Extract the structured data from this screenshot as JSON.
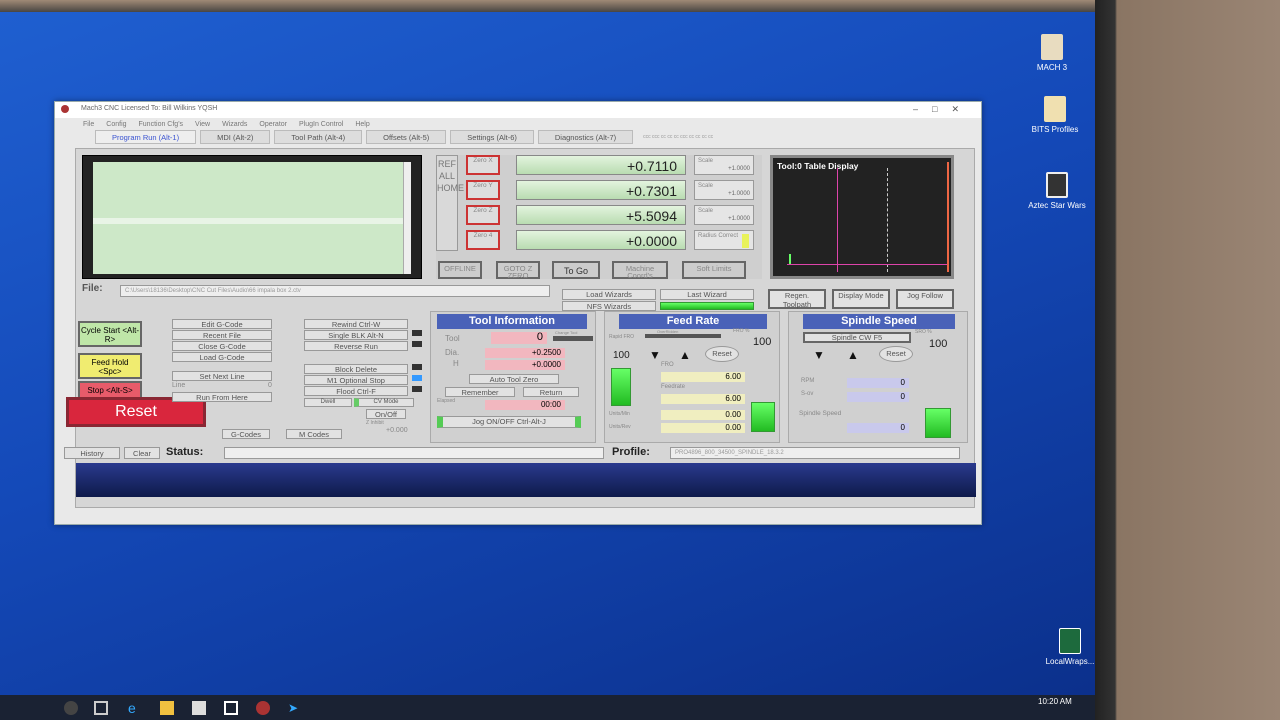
{
  "desktop": {
    "icons": [
      {
        "label": "MACH 3"
      },
      {
        "label": "BITS Profiles"
      },
      {
        "label": "Aztec Star Wars"
      },
      {
        "label": "LocalWraps..."
      }
    ]
  },
  "window": {
    "title": "Mach3 CNC  Licensed To: Bill Wilkins YQSH",
    "menu": [
      "File",
      "Config",
      "Function Cfg's",
      "View",
      "Wizards",
      "Operator",
      "PlugIn Control",
      "Help"
    ],
    "tabs": [
      "Program Run (Alt-1)",
      "MDI (Alt-2)",
      "Tool Path (Alt-4)",
      "Offsets (Alt-5)",
      "Settings (Alt-6)",
      "Diagnostics (Alt-7)"
    ],
    "tab_ticker": "ccc ccc cc cc cc ccc cc cc cc cc"
  },
  "dro": {
    "ref_all_home": "REF ALL HOME",
    "axes": [
      {
        "zero_label": "Zero X",
        "value": "+0.7110",
        "scale_label": "Scale",
        "scale": "+1.0000"
      },
      {
        "zero_label": "Zero Y",
        "value": "+0.7301",
        "scale_label": "Scale",
        "scale": "+1.0000"
      },
      {
        "zero_label": "Zero Z",
        "value": "+5.5094",
        "scale_label": "Scale",
        "scale": "+1.0000"
      },
      {
        "zero_label": "Zero 4",
        "value": "+0.0000",
        "scale_label": "Radius Correct",
        "scale": ""
      }
    ],
    "buttons": [
      "OFFLINE",
      "GOTO Z ZERO",
      "To Go",
      "Machine Coord's",
      "Soft Limits"
    ]
  },
  "toolpath": {
    "title": "Tool:0   Table Display"
  },
  "file": {
    "label": "File:",
    "path": "C:\\Users\\18136\\Desktop\\CNC Cut Files\\Audio\\66 impala box 2.ctv"
  },
  "wizards": {
    "load": "Load Wizards",
    "last": "Last Wizard",
    "nfs": "NFS Wizards"
  },
  "view_buttons": [
    "Regen. Toolpath",
    "Display Mode",
    "Jog Follow"
  ],
  "program": {
    "cycle_start": "Cycle Start <Alt-R>",
    "feed_hold": "Feed Hold <Spc>",
    "stop": "Stop <Alt-S>",
    "reset": "Reset",
    "file_buttons": [
      "Edit G-Code",
      "Recent File",
      "Close G-Code",
      "Load G-Code"
    ],
    "set_next_line": "Set Next Line",
    "line_label": "Line",
    "line_value": "0",
    "run_from_here": "Run From Here",
    "run_buttons": [
      "Rewind Ctrl-W",
      "Single BLK Alt-N",
      "Reverse Run"
    ],
    "toggles": [
      "Block Delete",
      "M1 Optional Stop",
      "Flood Ctrl-F"
    ],
    "dwell": "Dwell",
    "cv_mode": "CV Mode",
    "on_off": "On/Off",
    "z_inhibit": "Z Inhibit",
    "z_inhibit_value": "+0.000",
    "gcodes": "G-Codes",
    "mcodes": "M Codes"
  },
  "tool_info": {
    "title": "Tool Information",
    "tool_label": "Tool",
    "tool_value": "0",
    "change": "Change Tool",
    "dia_label": "Dia.",
    "dia_value": "+0.2500",
    "h_label": "H",
    "h_value": "+0.0000",
    "auto_zero": "Auto Tool Zero",
    "remember": "Remember",
    "return": "Return",
    "elapsed_label": "Elapsed",
    "elapsed_value": "00:00",
    "jog_toggle": "Jog ON/OFF Ctrl-Alt-J"
  },
  "feed": {
    "title": "Feed Rate",
    "override_label": "OverRidden",
    "fro_pct_label": "FRO %",
    "fro_pct": "100",
    "rapid_fro_label": "Rapid FRO",
    "rapid_value": "100",
    "fro_label": "FRO",
    "fro_value": "6.00",
    "feedrate_label": "Feedrate",
    "feedrate_value": "6.00",
    "units_min_label": "Units/Min",
    "units_min_value": "0.00",
    "units_rev_label": "Units/Rev",
    "units_rev_value": "0.00",
    "reset": "Reset"
  },
  "spindle": {
    "title": "Spindle Speed",
    "cw_button": "Spindle CW F5",
    "sro_label": "SRO %",
    "sro_value": "100",
    "rpm_label": "RPM",
    "rpm_value": "0",
    "sov_label": "S-ov",
    "sov_value": "0",
    "speed_label": "Spindle Speed",
    "speed_value": "0",
    "reset": "Reset"
  },
  "status": {
    "history": "History",
    "clear": "Clear",
    "status_label": "Status:",
    "profile_label": "Profile:",
    "profile_value": "PRO4896_800_34500_SPINDLE_18.3.2"
  },
  "taskbar": {
    "clock": "10:20 AM"
  },
  "colors": {
    "accent": "#4a62b8",
    "reset_red": "#d9263d",
    "dro_green": "#b9dcb1",
    "desktop_blue": "#1449b8"
  }
}
